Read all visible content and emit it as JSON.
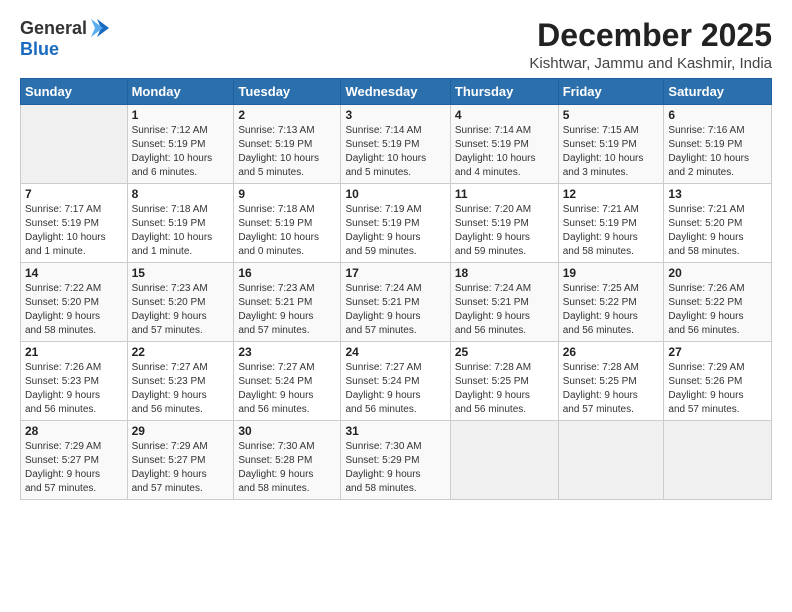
{
  "logo": {
    "general": "General",
    "blue": "Blue"
  },
  "header": {
    "title": "December 2025",
    "subtitle": "Kishtwar, Jammu and Kashmir, India"
  },
  "weekdays": [
    "Sunday",
    "Monday",
    "Tuesday",
    "Wednesday",
    "Thursday",
    "Friday",
    "Saturday"
  ],
  "weeks": [
    [
      {
        "day": "",
        "info": ""
      },
      {
        "day": "1",
        "info": "Sunrise: 7:12 AM\nSunset: 5:19 PM\nDaylight: 10 hours\nand 6 minutes."
      },
      {
        "day": "2",
        "info": "Sunrise: 7:13 AM\nSunset: 5:19 PM\nDaylight: 10 hours\nand 5 minutes."
      },
      {
        "day": "3",
        "info": "Sunrise: 7:14 AM\nSunset: 5:19 PM\nDaylight: 10 hours\nand 5 minutes."
      },
      {
        "day": "4",
        "info": "Sunrise: 7:14 AM\nSunset: 5:19 PM\nDaylight: 10 hours\nand 4 minutes."
      },
      {
        "day": "5",
        "info": "Sunrise: 7:15 AM\nSunset: 5:19 PM\nDaylight: 10 hours\nand 3 minutes."
      },
      {
        "day": "6",
        "info": "Sunrise: 7:16 AM\nSunset: 5:19 PM\nDaylight: 10 hours\nand 2 minutes."
      }
    ],
    [
      {
        "day": "7",
        "info": "Sunrise: 7:17 AM\nSunset: 5:19 PM\nDaylight: 10 hours\nand 1 minute."
      },
      {
        "day": "8",
        "info": "Sunrise: 7:18 AM\nSunset: 5:19 PM\nDaylight: 10 hours\nand 1 minute."
      },
      {
        "day": "9",
        "info": "Sunrise: 7:18 AM\nSunset: 5:19 PM\nDaylight: 10 hours\nand 0 minutes."
      },
      {
        "day": "10",
        "info": "Sunrise: 7:19 AM\nSunset: 5:19 PM\nDaylight: 9 hours\nand 59 minutes."
      },
      {
        "day": "11",
        "info": "Sunrise: 7:20 AM\nSunset: 5:19 PM\nDaylight: 9 hours\nand 59 minutes."
      },
      {
        "day": "12",
        "info": "Sunrise: 7:21 AM\nSunset: 5:19 PM\nDaylight: 9 hours\nand 58 minutes."
      },
      {
        "day": "13",
        "info": "Sunrise: 7:21 AM\nSunset: 5:20 PM\nDaylight: 9 hours\nand 58 minutes."
      }
    ],
    [
      {
        "day": "14",
        "info": "Sunrise: 7:22 AM\nSunset: 5:20 PM\nDaylight: 9 hours\nand 58 minutes."
      },
      {
        "day": "15",
        "info": "Sunrise: 7:23 AM\nSunset: 5:20 PM\nDaylight: 9 hours\nand 57 minutes."
      },
      {
        "day": "16",
        "info": "Sunrise: 7:23 AM\nSunset: 5:21 PM\nDaylight: 9 hours\nand 57 minutes."
      },
      {
        "day": "17",
        "info": "Sunrise: 7:24 AM\nSunset: 5:21 PM\nDaylight: 9 hours\nand 57 minutes."
      },
      {
        "day": "18",
        "info": "Sunrise: 7:24 AM\nSunset: 5:21 PM\nDaylight: 9 hours\nand 56 minutes."
      },
      {
        "day": "19",
        "info": "Sunrise: 7:25 AM\nSunset: 5:22 PM\nDaylight: 9 hours\nand 56 minutes."
      },
      {
        "day": "20",
        "info": "Sunrise: 7:26 AM\nSunset: 5:22 PM\nDaylight: 9 hours\nand 56 minutes."
      }
    ],
    [
      {
        "day": "21",
        "info": "Sunrise: 7:26 AM\nSunset: 5:23 PM\nDaylight: 9 hours\nand 56 minutes."
      },
      {
        "day": "22",
        "info": "Sunrise: 7:27 AM\nSunset: 5:23 PM\nDaylight: 9 hours\nand 56 minutes."
      },
      {
        "day": "23",
        "info": "Sunrise: 7:27 AM\nSunset: 5:24 PM\nDaylight: 9 hours\nand 56 minutes."
      },
      {
        "day": "24",
        "info": "Sunrise: 7:27 AM\nSunset: 5:24 PM\nDaylight: 9 hours\nand 56 minutes."
      },
      {
        "day": "25",
        "info": "Sunrise: 7:28 AM\nSunset: 5:25 PM\nDaylight: 9 hours\nand 56 minutes."
      },
      {
        "day": "26",
        "info": "Sunrise: 7:28 AM\nSunset: 5:25 PM\nDaylight: 9 hours\nand 57 minutes."
      },
      {
        "day": "27",
        "info": "Sunrise: 7:29 AM\nSunset: 5:26 PM\nDaylight: 9 hours\nand 57 minutes."
      }
    ],
    [
      {
        "day": "28",
        "info": "Sunrise: 7:29 AM\nSunset: 5:27 PM\nDaylight: 9 hours\nand 57 minutes."
      },
      {
        "day": "29",
        "info": "Sunrise: 7:29 AM\nSunset: 5:27 PM\nDaylight: 9 hours\nand 57 minutes."
      },
      {
        "day": "30",
        "info": "Sunrise: 7:30 AM\nSunset: 5:28 PM\nDaylight: 9 hours\nand 58 minutes."
      },
      {
        "day": "31",
        "info": "Sunrise: 7:30 AM\nSunset: 5:29 PM\nDaylight: 9 hours\nand 58 minutes."
      },
      {
        "day": "",
        "info": ""
      },
      {
        "day": "",
        "info": ""
      },
      {
        "day": "",
        "info": ""
      }
    ]
  ]
}
